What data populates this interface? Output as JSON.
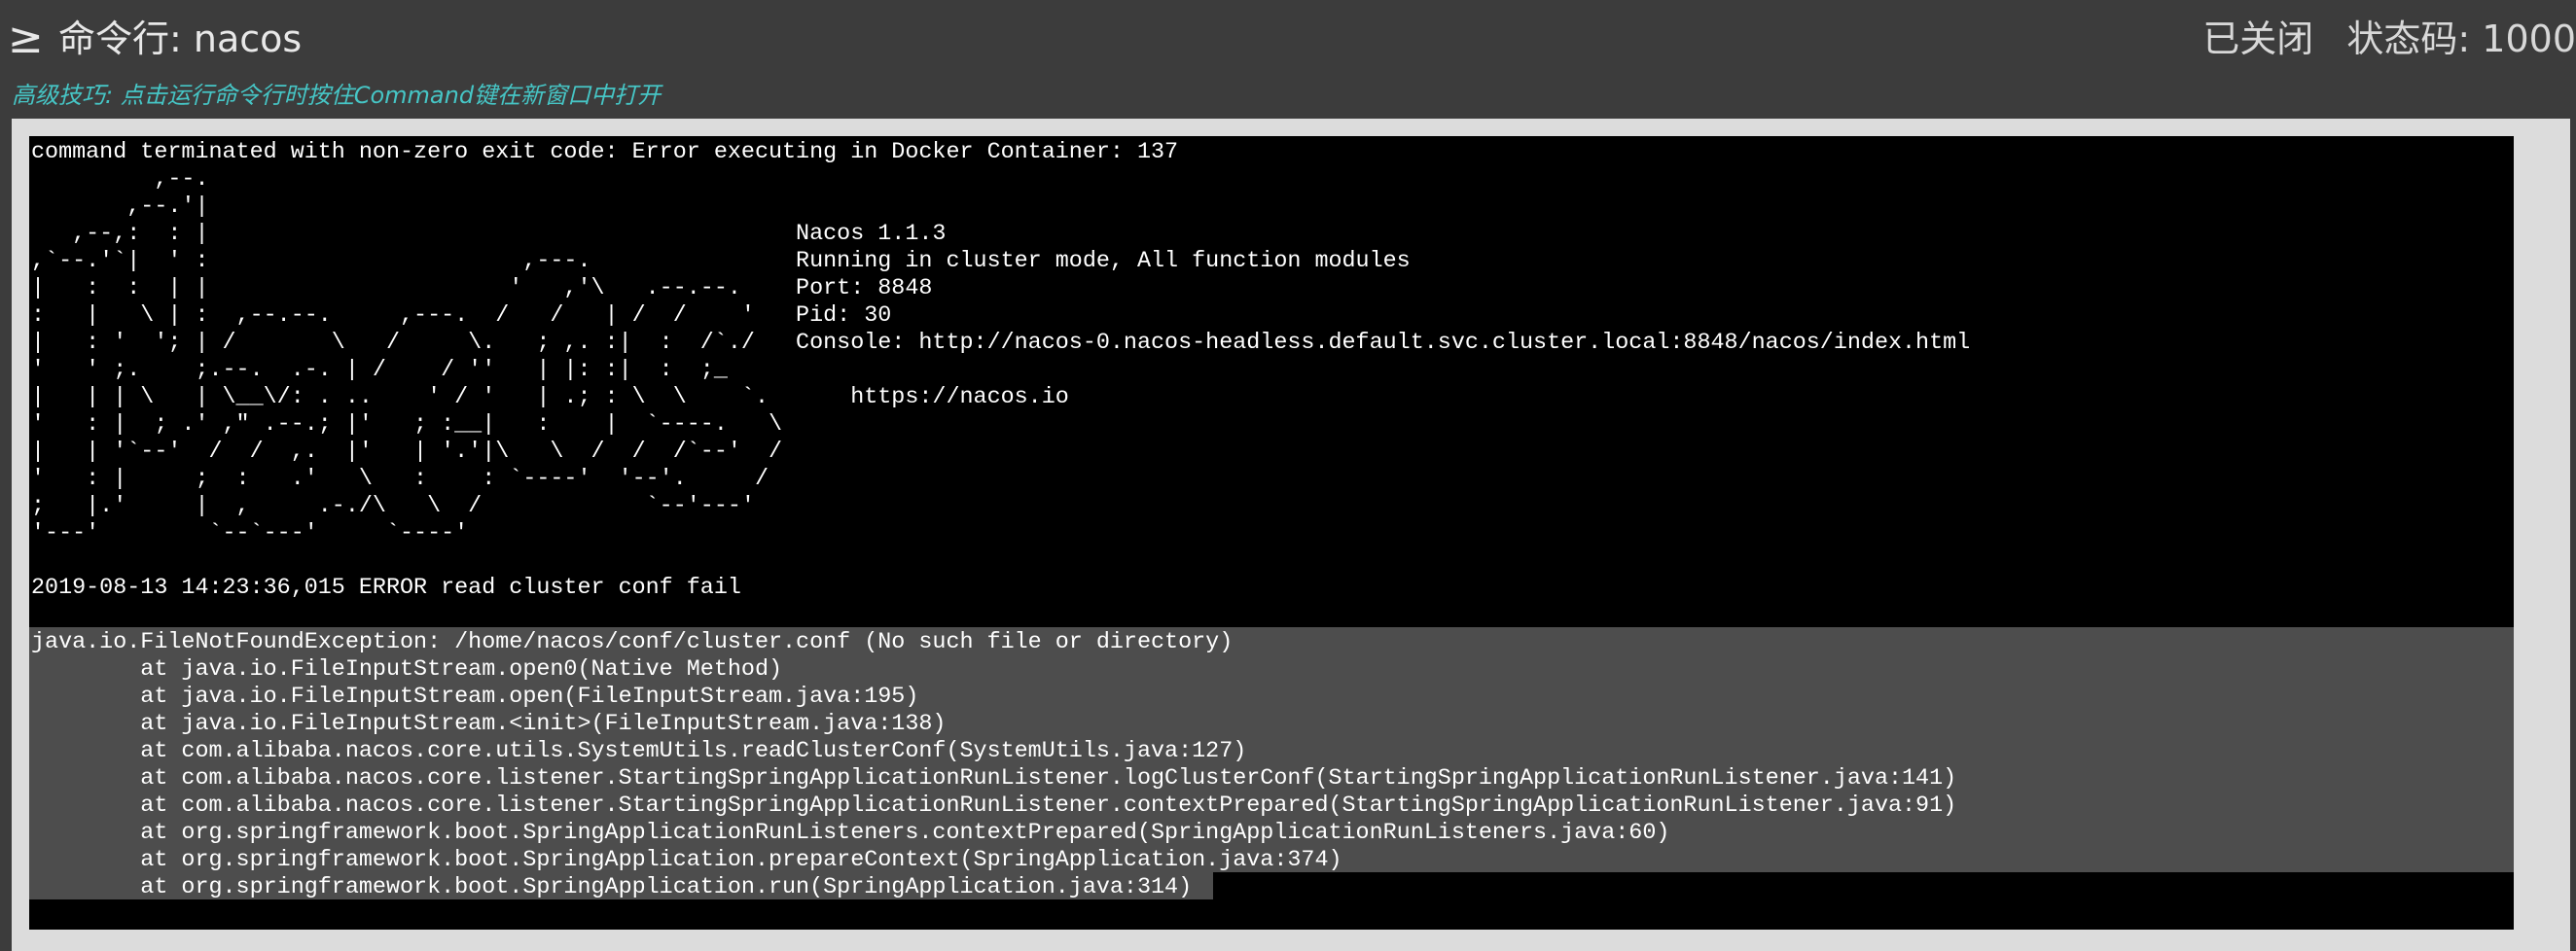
{
  "header": {
    "prompt_icon": "≥",
    "title": "命令行: nacos",
    "status_closed": "已关闭",
    "status_code": "状态码: 1000"
  },
  "tip": "高级技巧: 点击运行命令行时按住Command键在新窗口中打开",
  "terminal": {
    "exit_line": "command terminated with non-zero exit code: Error executing in Docker Container: 137",
    "banner": [
      "         ,--.",
      "       ,--.'|",
      "   ,--,:  : |                                           Nacos 1.1.3",
      ",`--.'`|  ' :                       ,---.               Running in cluster mode, All function modules",
      "|   :  :  | |                      '   ,'\\   .--.--.    Port: 8848",
      ":   |   \\ | :  ,--.--.     ,---.  /   /   | /  /    '   Pid: 30",
      "|   : '  '; | /       \\   /     \\.   ; ,. :|  :  /`./   Console: http://nacos-0.nacos-headless.default.svc.cluster.local:8848/nacos/index.html",
      "'   ' ;.    ;.--.  .-. | /    / ''   | |: :|  :  ;_",
      "|   | | \\   | \\__\\/: . ..    ' / '   | .; : \\  \\    `.      https://nacos.io",
      "'   : |  ; .' ,\" .--.; |'   ; :__|   :    |  `----.   \\",
      "|   | '`--'  /  /  ,.  |'   | '.'|\\   \\  /  /  /`--'  /",
      "'   : |     ;  :   .'   \\   :    : `----'  '--'.     /",
      ";   |.'     |  ,     .-./\\   \\  /            `--'---'",
      "'---'        `--`---'     `----'"
    ],
    "error_line": "2019-08-13 14:23:36,015 ERROR read cluster conf fail",
    "stack": [
      "java.io.FileNotFoundException: /home/nacos/conf/cluster.conf (No such file or directory)",
      "        at java.io.FileInputStream.open0(Native Method)",
      "        at java.io.FileInputStream.open(FileInputStream.java:195)",
      "        at java.io.FileInputStream.<init>(FileInputStream.java:138)",
      "        at com.alibaba.nacos.core.utils.SystemUtils.readClusterConf(SystemUtils.java:127)",
      "        at com.alibaba.nacos.core.listener.StartingSpringApplicationRunListener.logClusterConf(StartingSpringApplicationRunListener.java:141)",
      "        at com.alibaba.nacos.core.listener.StartingSpringApplicationRunListener.contextPrepared(StartingSpringApplicationRunListener.java:91)",
      "        at org.springframework.boot.SpringApplicationRunListeners.contextPrepared(SpringApplicationRunListeners.java:60)",
      "        at org.springframework.boot.SpringApplication.prepareContext(SpringApplication.java:374)",
      "        at org.springframework.boot.SpringApplication.run(SpringApplication.java:314)"
    ]
  },
  "colors": {
    "background": "#3c3c3c",
    "terminal_bg": "#000000",
    "terminal_text": "#ffffff",
    "selection": "#4d4d4d",
    "tip": "#46c6c6"
  }
}
